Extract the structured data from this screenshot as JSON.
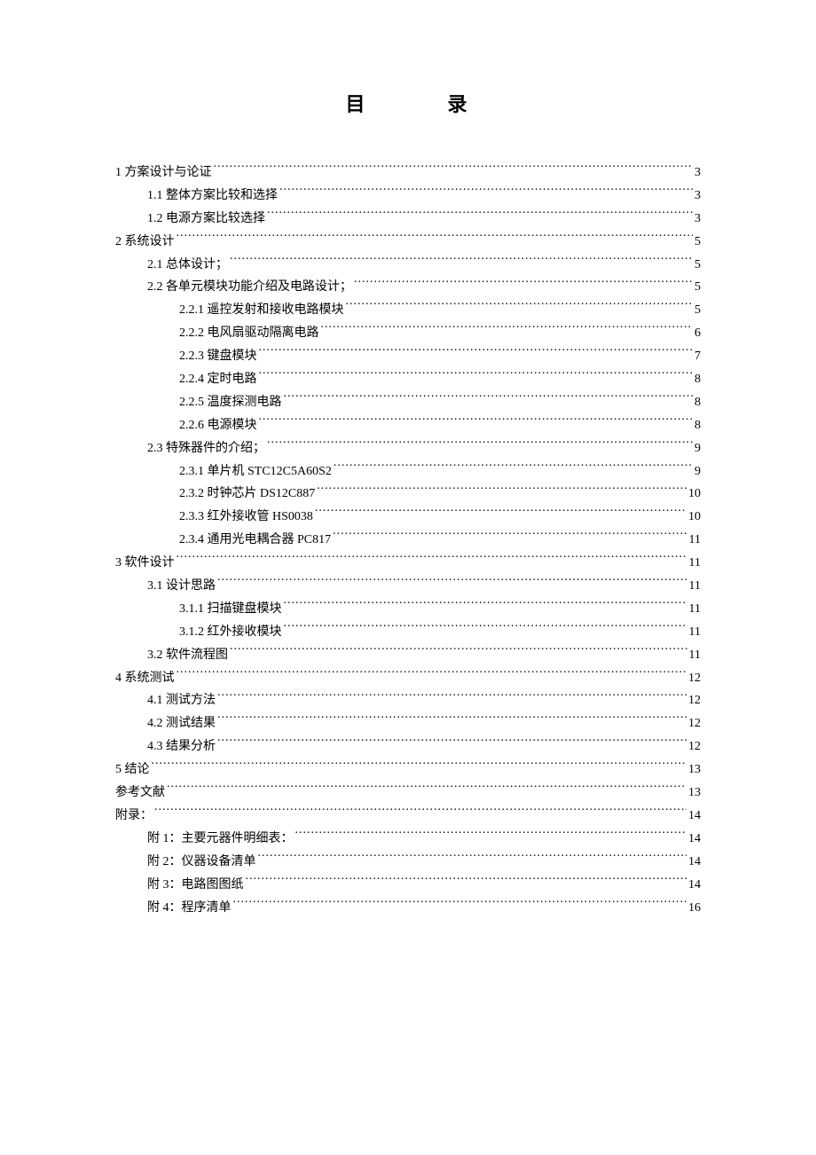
{
  "title_left": "目",
  "title_right": "录",
  "toc": [
    {
      "level": 0,
      "label": "1 方案设计与论证",
      "page": "3"
    },
    {
      "level": 1,
      "label": "1.1 整体方案比较和选择",
      "page": "3"
    },
    {
      "level": 1,
      "label": "1.2 电源方案比较选择",
      "page": "3"
    },
    {
      "level": 0,
      "label": "2 系统设计",
      "page": "5"
    },
    {
      "level": 1,
      "label": "2.1 总体设计；",
      "page": "5"
    },
    {
      "level": 1,
      "label": "2.2 各单元模块功能介绍及电路设计；",
      "page": "5"
    },
    {
      "level": 2,
      "label": "2.2.1 遥控发射和接收电路模块",
      "page": "5"
    },
    {
      "level": 2,
      "label": "2.2.2 电风扇驱动隔离电路",
      "page": "6"
    },
    {
      "level": 2,
      "label": "2.2.3 键盘模块",
      "page": "7"
    },
    {
      "level": 2,
      "label": "2.2.4 定时电路",
      "page": "8"
    },
    {
      "level": 2,
      "label": "2.2.5 温度探测电路",
      "page": "8"
    },
    {
      "level": 2,
      "label": "2.2.6 电源模块",
      "page": "8"
    },
    {
      "level": 1,
      "label": "2.3 特殊器件的介绍；",
      "page": "9"
    },
    {
      "level": 2,
      "label": "2.3.1 单片机 STC12C5A60S2",
      "page": "9"
    },
    {
      "level": 2,
      "label": "2.3.2 时钟芯片 DS12C887",
      "page": "10"
    },
    {
      "level": 2,
      "label": "2.3.3 红外接收管 HS0038",
      "page": "10"
    },
    {
      "level": 2,
      "label": "2.3.4 通用光电耦合器 PC817",
      "page": "11"
    },
    {
      "level": 0,
      "label": "3 软件设计",
      "page": "11"
    },
    {
      "level": 1,
      "label": "3.1 设计思路",
      "page": "11"
    },
    {
      "level": 2,
      "label": "3.1.1 扫描键盘模块",
      "page": "11"
    },
    {
      "level": 2,
      "label": "3.1.2 红外接收模块",
      "page": "11"
    },
    {
      "level": 1,
      "label": "3.2 软件流程图",
      "page": "11"
    },
    {
      "level": 0,
      "label": "4 系统测试",
      "page": "12"
    },
    {
      "level": 1,
      "label": "4.1 测试方法",
      "page": "12"
    },
    {
      "level": 1,
      "label": "4.2 测试结果",
      "page": "12"
    },
    {
      "level": 1,
      "label": "4.3 结果分析",
      "page": "12"
    },
    {
      "level": 0,
      "label": "5 结论",
      "page": "13"
    },
    {
      "level": 0,
      "label": "参考文献",
      "page": "13"
    },
    {
      "level": 0,
      "label": "附录：",
      "page": "14"
    },
    {
      "level": 1,
      "label": "附 1：主要元器件明细表：",
      "page": "14"
    },
    {
      "level": 1,
      "label": "附 2：仪器设备清单",
      "page": "14"
    },
    {
      "level": 1,
      "label": "附 3：电路图图纸",
      "page": "14"
    },
    {
      "level": 1,
      "label": "附 4：程序清单",
      "page": "16"
    }
  ]
}
